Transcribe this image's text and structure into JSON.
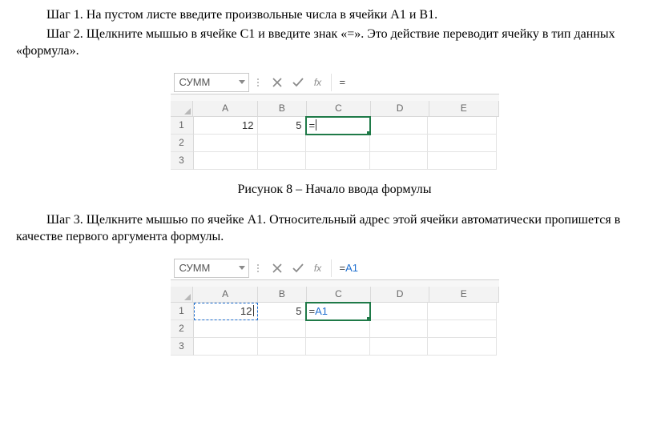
{
  "text": {
    "step1": "Шаг 1. На пустом листе введите произвольные числа в ячейки А1 и В1.",
    "step2": "Шаг 2. Щелкните мышью в ячейке С1 и введите знак «=». Это действие переводит ячейку в тип данных «формула».",
    "caption1": "Рисунок 8 – Начало ввода формулы",
    "step3": "Шаг 3. Щелкните мышью по ячейке А1. Относительный адрес этой ячейки автоматически пропишется в качестве первого аргумента формулы."
  },
  "fig1": {
    "namebox": "СУММ",
    "fx": "fx",
    "formula": "=",
    "cols": {
      "A": "A",
      "B": "B",
      "C": "C",
      "D": "D",
      "E": "E"
    },
    "rows": {
      "r1": "1",
      "r2": "2",
      "r3": "3"
    },
    "cells": {
      "A1": "12",
      "B1": "5",
      "C1": "="
    }
  },
  "fig2": {
    "namebox": "СУММ",
    "fx": "fx",
    "formula_eq": "=",
    "formula_ref": "A1",
    "cols": {
      "A": "A",
      "B": "B",
      "C": "C",
      "D": "D",
      "E": "E"
    },
    "rows": {
      "r1": "1",
      "r2": "2",
      "r3": "3"
    },
    "cells": {
      "A1": "12",
      "B1": "5",
      "C1_eq": "=",
      "C1_ref": "A1"
    }
  }
}
